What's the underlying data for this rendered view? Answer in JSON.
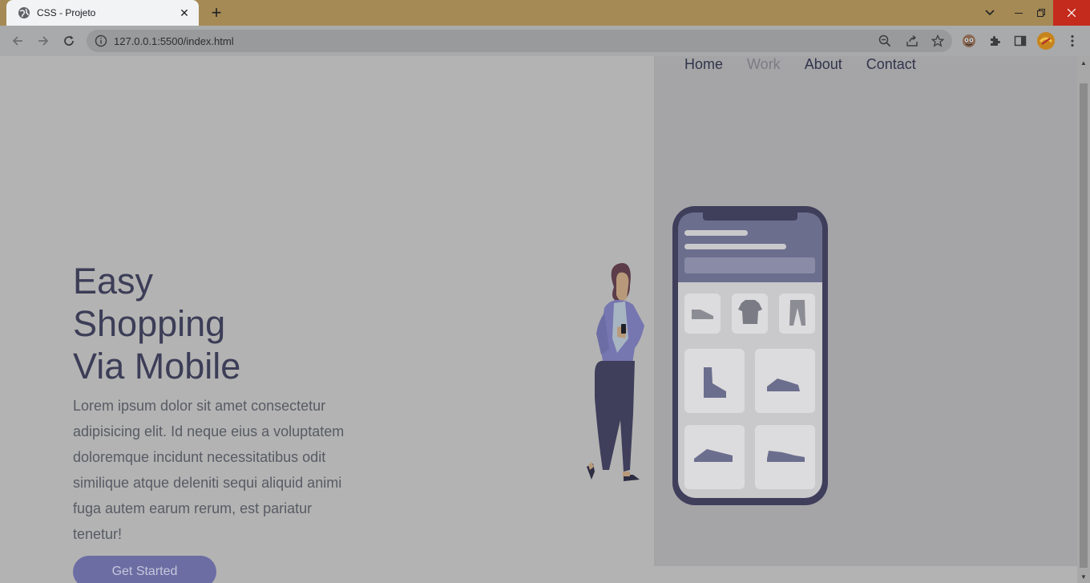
{
  "browser": {
    "tab_title": "CSS - Projeto",
    "url": "127.0.0.1:5500/index.html"
  },
  "nav": {
    "home": "Home",
    "work": "Work",
    "about": "About",
    "contact": "Contact"
  },
  "hero": {
    "title_line1": "Easy",
    "title_line2": "Shopping",
    "title_line3": "Via Mobile",
    "paragraph": "Lorem ipsum dolor sit amet consectetur adipisicing elit. Id neque eius a voluptatem doloremque incidunt necessitatibus odit similique atque deleniti sequi aliquid animi fuga autem earum rerum, est pariatur tenetur!",
    "cta_label": "Get Started"
  },
  "colors": {
    "tab_strip": "#a58a55",
    "overlay_bg": "#b3b3b3",
    "panel_bg": "#a5a5a7",
    "title": "#3c3d57",
    "cta_bg": "#6c6da3",
    "close_red": "#c42b1c"
  }
}
